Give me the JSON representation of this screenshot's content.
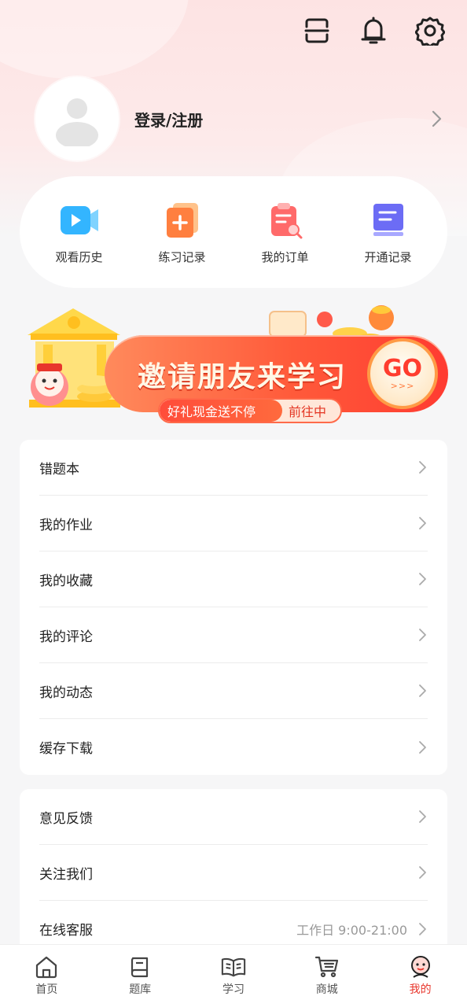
{
  "header": {
    "icons": [
      "scan-icon",
      "bell-icon",
      "gear-icon"
    ]
  },
  "profile": {
    "login_label": "登录/注册"
  },
  "quick_actions": [
    {
      "label": "观看历史",
      "icon": "video-icon",
      "color": "#35b6ff"
    },
    {
      "label": "练习记录",
      "icon": "practice-icon",
      "color": "#ff8a4c"
    },
    {
      "label": "我的订单",
      "icon": "order-icon",
      "color": "#ff6b6b"
    },
    {
      "label": "开通记录",
      "icon": "record-icon",
      "color": "#6f6bff"
    }
  ],
  "banner": {
    "title": "邀请朋友来学习",
    "subtitle": "好礼现金送不停",
    "action": "前往中",
    "go": "GO",
    "arrows": ">>>"
  },
  "menu_group_1": [
    {
      "label": "错题本"
    },
    {
      "label": "我的作业"
    },
    {
      "label": "我的收藏"
    },
    {
      "label": "我的评论"
    },
    {
      "label": "我的动态"
    },
    {
      "label": "缓存下载"
    }
  ],
  "menu_group_2": [
    {
      "label": "意见反馈",
      "extra": ""
    },
    {
      "label": "关注我们",
      "extra": ""
    },
    {
      "label": "在线客服",
      "extra": "工作日 9:00-21:00"
    }
  ],
  "tabbar": [
    {
      "label": "首页",
      "icon": "home-icon",
      "active": false
    },
    {
      "label": "题库",
      "icon": "book-icon",
      "active": false
    },
    {
      "label": "学习",
      "icon": "open-book-icon",
      "active": false
    },
    {
      "label": "商城",
      "icon": "cart-icon",
      "active": false
    },
    {
      "label": "我的",
      "icon": "profile-icon",
      "active": true
    }
  ],
  "colors": {
    "accent": "#e8362c",
    "top_bg": "#fde3e3"
  }
}
